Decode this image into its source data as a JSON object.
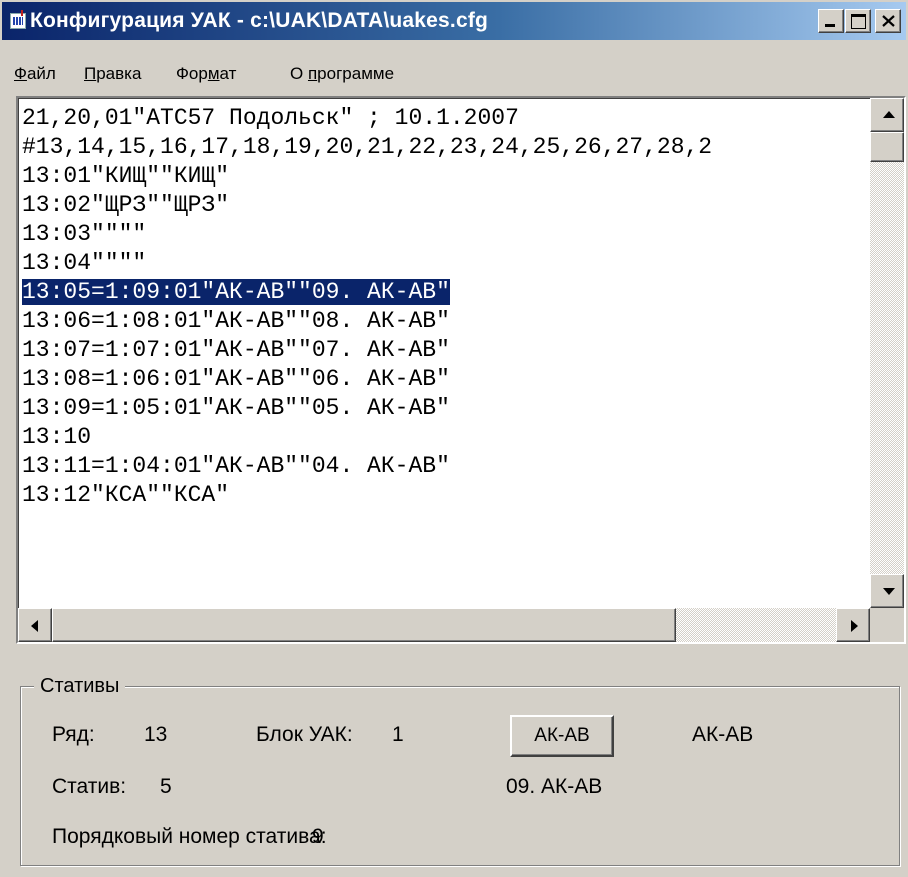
{
  "window": {
    "title": "Конфигурация УАК - c:\\UAK\\DATA\\uakes.cfg"
  },
  "menu": {
    "file": {
      "pre": "",
      "key": "Ф",
      "post": "айл"
    },
    "edit": {
      "pre": "",
      "key": "П",
      "post": "равка"
    },
    "format": {
      "pre": "Фор",
      "key": "м",
      "post": "ат"
    },
    "about": {
      "pre": "О ",
      "key": "п",
      "post": "рограмме"
    }
  },
  "editor": {
    "lines": [
      "21,20,01\"АТС57 Подольск\" ; 10.1.2007",
      "#13,14,15,16,17,18,19,20,21,22,23,24,25,26,27,28,2",
      "13:01\"КИЩ\"\"КИЩ\"",
      "13:02\"ЩРЗ\"\"ЩРЗ\"",
      "13:03\"\"\"\"",
      "13:04\"\"\"\"",
      "13:05=1:09:01\"АК-АВ\"\"09. АК-АВ\"",
      "13:06=1:08:01\"АК-АВ\"\"08. АК-АВ\"",
      "13:07=1:07:01\"АК-АВ\"\"07. АК-АВ\"",
      "13:08=1:06:01\"АК-АВ\"\"06. АК-АВ\"",
      "13:09=1:05:01\"АК-АВ\"\"05. АК-АВ\"",
      "13:10",
      "13:11=1:04:01\"АК-АВ\"\"04. АК-АВ\"",
      "13:12\"КСА\"\"КСА\""
    ],
    "selected_line_index": 6
  },
  "stands": {
    "group_title": "Стативы",
    "row_label": "Ряд:",
    "row_value": "13",
    "block_label": "Блок УАК:",
    "block_value": "1",
    "button_label": "АК-АВ",
    "type_value": "АК-АВ",
    "stand_label": "Статив:",
    "stand_value": "5",
    "stand_name": "09. АК-АВ",
    "serial_label": "Порядковый номер статива:",
    "serial_value": "9"
  }
}
